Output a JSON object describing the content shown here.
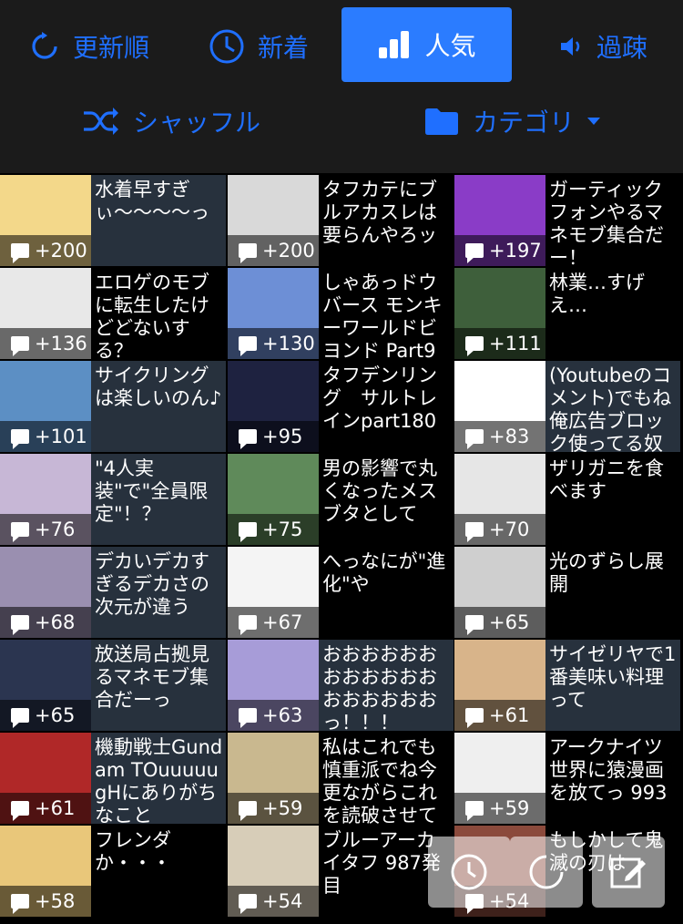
{
  "tabs": {
    "updated": "更新順",
    "new": "新着",
    "popular": "人気",
    "sparse": "過疎",
    "shuffle": "シャッフル",
    "category": "カテゴリ"
  },
  "colors": {
    "accent": "#1f6fff",
    "active_bg": "#2b7cff",
    "header_bg": "#1b1b1b",
    "alt_cell": "#27313d"
  },
  "threads": [
    {
      "title": "水着早すぎぃ〜〜〜〜っ",
      "count": "+200",
      "thumb": "#f3d88a"
    },
    {
      "title": "タフカテにブルアカスレは要らんやろッ",
      "count": "+200",
      "thumb": "#d9d9d9"
    },
    {
      "title": "ガーティックフォンやるマネモブ集合だー！",
      "count": "+197",
      "thumb": "#8a3cc7"
    },
    {
      "title": "エロゲのモブに転生したけどどないする？",
      "count": "+136",
      "thumb": "#e8e8e8"
    },
    {
      "title": "しゃあっドウバース モンキーワールドビヨンド Part9",
      "count": "+130",
      "thumb": "#6d8fd6"
    },
    {
      "title": "林業…すげえ…",
      "count": "+111",
      "thumb": "#3e5f3b"
    },
    {
      "title": "サイクリングは楽しいのん♪",
      "count": "+101",
      "thumb": "#5c8fc4"
    },
    {
      "title": "タフデンリング　サルトレインpart180",
      "count": "+95",
      "thumb": "#1e2240"
    },
    {
      "title": "(Youtubeのコメント)でもね俺広告ブロック使ってる奴",
      "count": "+83",
      "thumb": "#ffffff"
    },
    {
      "title": "\"4人実装\"で\"全員限定\"！？",
      "count": "+76",
      "thumb": "#c7b7d6"
    },
    {
      "title": "男の影響で丸くなったメスブタとして",
      "count": "+75",
      "thumb": "#5f8a5a"
    },
    {
      "title": "ザリガニを食べます",
      "count": "+70",
      "thumb": "#e6e6e6"
    },
    {
      "title": "デカいデカすぎるデカさの次元が違う",
      "count": "+68",
      "thumb": "#9a8fb0"
    },
    {
      "title": "へっなにが\"進化\"や",
      "count": "+67",
      "thumb": "#f4f4f4"
    },
    {
      "title": "光のずらし展開",
      "count": "+65",
      "thumb": "#cfcfcf"
    },
    {
      "title": "放送局占拠見るマネモブ集合だーっ",
      "count": "+65",
      "thumb": "#2b3550"
    },
    {
      "title": "おおおおおおおおおおおおおおおおおお っ！！！",
      "count": "+63",
      "thumb": "#a79cd8"
    },
    {
      "title": "サイゼリヤで1番美味い料理って",
      "count": "+61",
      "thumb": "#d8b48a"
    },
    {
      "title": "機動戦士Gundam TOuuuuugHにありがちなこと",
      "count": "+61",
      "thumb": "#b02828"
    },
    {
      "title": "私はこれでも慎重派でね今更ながらこれを読破させて",
      "count": "+59",
      "thumb": "#c9b88f"
    },
    {
      "title": "アークナイツ世界に猿漫画を放てっ 993",
      "count": "+59",
      "thumb": "#efefef"
    },
    {
      "title": "フレンダか・・・",
      "count": "+58",
      "thumb": "#e9c77a"
    },
    {
      "title": "ブルーアーカイタフ 987発目",
      "count": "+54",
      "thumb": "#d7cdb8"
    },
    {
      "title": "もしかして鬼滅の刃は",
      "count": "+54",
      "thumb": "#8b4a3c"
    }
  ]
}
